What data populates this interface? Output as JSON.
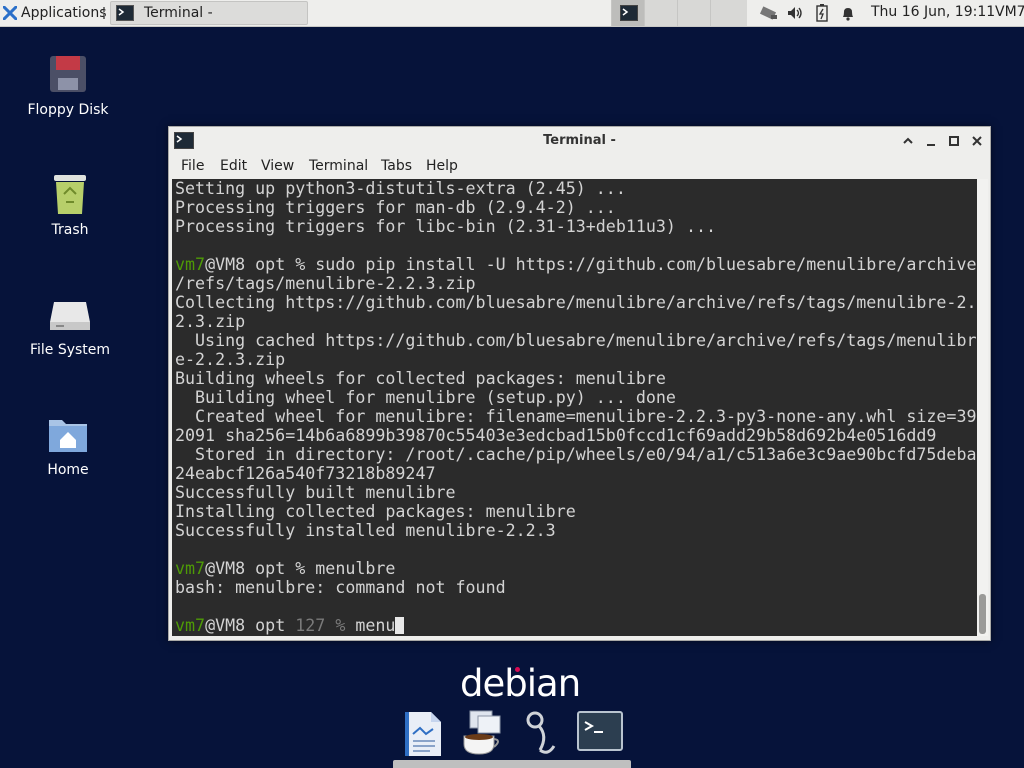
{
  "panel": {
    "apps_label": "Applications",
    "task_title": "Terminal -",
    "clock": "Thu 16 Jun, 19:11",
    "user": "VM7",
    "tray_icons": [
      "network-icon",
      "volume-icon",
      "battery-icon",
      "notification-bell-icon"
    ]
  },
  "desktop": {
    "icons": [
      {
        "label": "Floppy Disk",
        "icon": "floppy-disk-icon"
      },
      {
        "label": "Trash",
        "icon": "trash-icon"
      },
      {
        "label": "File System",
        "icon": "hard-drive-icon"
      },
      {
        "label": "Home",
        "icon": "home-folder-icon"
      }
    ]
  },
  "window": {
    "title": "Terminal -",
    "menu": [
      "File",
      "Edit",
      "View",
      "Terminal",
      "Tabs",
      "Help"
    ]
  },
  "terminal": {
    "lines": [
      {
        "t": "Setting up python3-distutils-extra (2.45) ..."
      },
      {
        "t": "Processing triggers for man-db (2.9.4-2) ..."
      },
      {
        "t": "Processing triggers for libc-bin (2.31-13+deb11u3) ..."
      },
      {
        "t": ""
      },
      {
        "prompt": "vm7",
        "host": "@VM8 opt ",
        "sym": "% ",
        "cmd": "sudo pip install -U https://github.com/bluesabre/menulibre/archive"
      },
      {
        "t": "/refs/tags/menulibre-2.2.3.zip"
      },
      {
        "t": "Collecting https://github.com/bluesabre/menulibre/archive/refs/tags/menulibre-2."
      },
      {
        "t": "2.3.zip"
      },
      {
        "t": "  Using cached https://github.com/bluesabre/menulibre/archive/refs/tags/menulibr"
      },
      {
        "t": "e-2.2.3.zip"
      },
      {
        "t": "Building wheels for collected packages: menulibre"
      },
      {
        "t": "  Building wheel for menulibre (setup.py) ... done"
      },
      {
        "t": "  Created wheel for menulibre: filename=menulibre-2.2.3-py3-none-any.whl size=39"
      },
      {
        "t": "2091 sha256=14b6a6899b39870c55403e3edcbad15b0fccd1cf69add29b58d692b4e0516dd9"
      },
      {
        "t": "  Stored in directory: /root/.cache/pip/wheels/e0/94/a1/c513a6e3c9ae90bcfd75deba"
      },
      {
        "t": "24eabcf126a540f73218b89247"
      },
      {
        "t": "Successfully built menulibre"
      },
      {
        "t": "Installing collected packages: menulibre"
      },
      {
        "t": "Successfully installed menulibre-2.2.3"
      },
      {
        "t": ""
      },
      {
        "prompt": "vm7",
        "host": "@VM8 opt ",
        "sym": "% ",
        "cmd": "menulbre"
      },
      {
        "t": "bash: menulbre: command not found"
      },
      {
        "t": ""
      },
      {
        "prompt": "vm7",
        "host": "@VM8 opt ",
        "code": "127 ",
        "sym": "% ",
        "cmd": "menu",
        "cursor": true
      }
    ]
  },
  "logo": {
    "text": "debian"
  },
  "dock": {
    "items": [
      "text-editor-icon",
      "java-coffee-icon",
      "search-magnifier-icon",
      "terminal-icon"
    ]
  },
  "colors": {
    "desktop_bg": "#06133a",
    "terminal_bg": "#2b2b2b",
    "prompt_green": "#4e9a06",
    "panel_bg": "#eeeeec"
  }
}
